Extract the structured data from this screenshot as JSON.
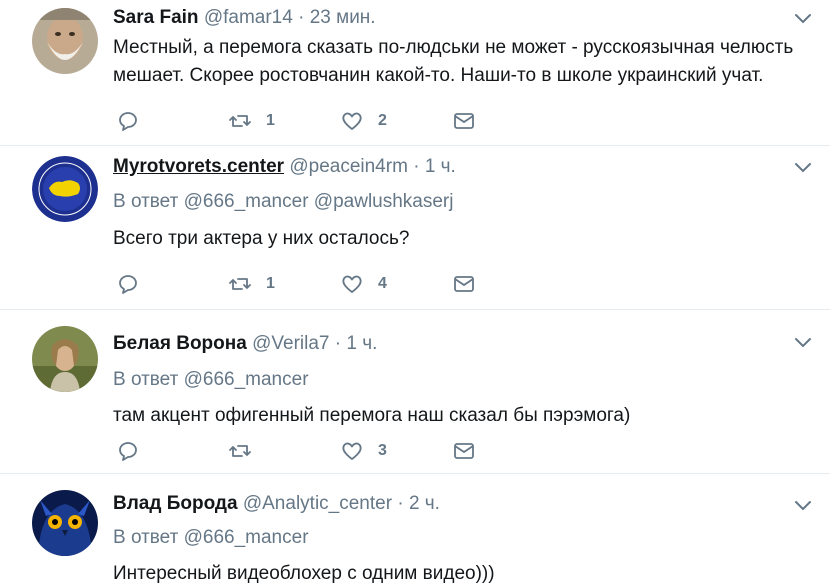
{
  "tweets": [
    {
      "name": "Sara Fain",
      "handle": "@famar14",
      "time": "23 мин.",
      "reply_label": "",
      "reply_to": "",
      "text": "Местный, а перемога сказать по-людськи не может - русскоязычная челюсть мешает.  Скорее ростовчанин какой-то.  Наши-то в школе украинский учат.",
      "retweets": "1",
      "likes": "2"
    },
    {
      "name": "Myrotvorets.center",
      "handle": "@peacein4rm",
      "time": "1 ч.",
      "reply_label": "В ответ",
      "reply_to": "@666_mancer @pawlushkaserj",
      "text": "Всего три актера у них осталось?",
      "retweets": "1",
      "likes": "4"
    },
    {
      "name": "Белая Ворона",
      "handle": "@Verila7",
      "time": "1 ч.",
      "reply_label": "В ответ",
      "reply_to": "@666_mancer",
      "text": "там акцент офигенный перемога наш сказал бы пэрэмога)",
      "retweets": "",
      "likes": "3"
    },
    {
      "name": "Влад Борода",
      "handle": "@Analytic_center",
      "time": "2 ч.",
      "reply_label": "В ответ",
      "reply_to": "@666_mancer",
      "text": "Интересный видеоблохер с одним видео)))"
    }
  ],
  "separator": "·",
  "icons": {
    "reply": "reply-icon",
    "retweet": "retweet-icon",
    "like": "heart-icon",
    "message": "envelope-icon",
    "menu": "chevron-down-icon"
  },
  "colors": {
    "text": "#14171a",
    "muted": "#657786",
    "divider": "#e6ecf0"
  }
}
